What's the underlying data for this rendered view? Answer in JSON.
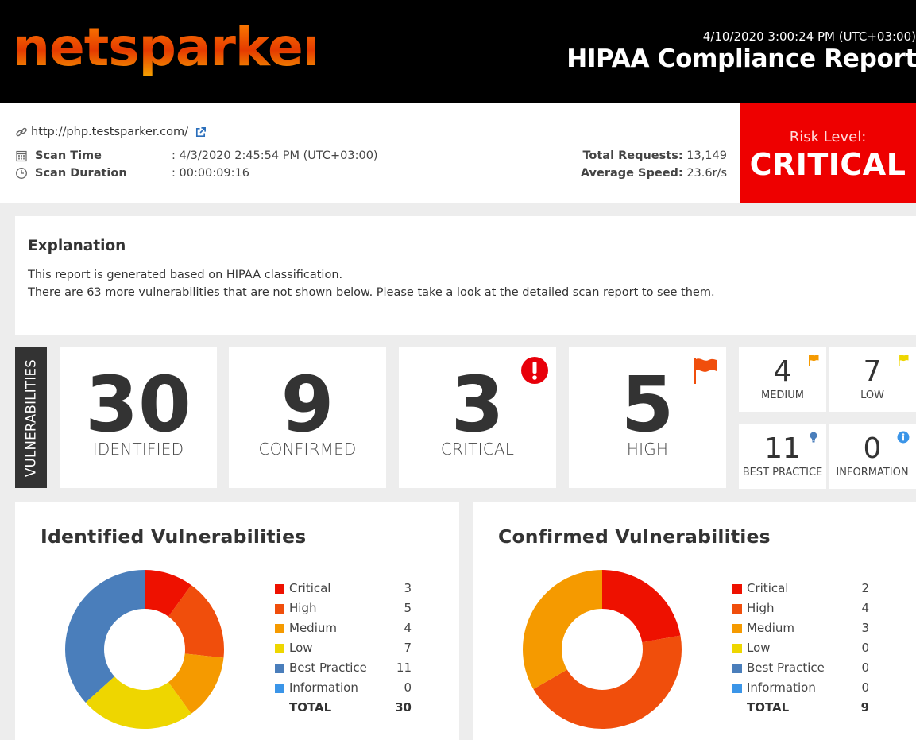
{
  "header": {
    "logo_text": "netsparker",
    "date": "4/10/2020 3:00:24 PM (UTC+03:00)",
    "title": "HIPAA Compliance Report"
  },
  "scan": {
    "url": "http://php.testsparker.com/",
    "scan_time_label": "Scan Time",
    "scan_time_value": ": 4/3/2020 2:45:54 PM (UTC+03:00)",
    "scan_duration_label": "Scan Duration",
    "scan_duration_value": ": 00:00:09:16",
    "total_requests_label": "Total Requests:",
    "total_requests_value": "13,149",
    "average_speed_label": "Average Speed:",
    "average_speed_value": "23.6r/s"
  },
  "risk": {
    "label": "Risk Level:",
    "value": "CRITICAL",
    "color": "#ee0000"
  },
  "explanation": {
    "heading": "Explanation",
    "line1": "This report is generated based on HIPAA classification.",
    "line2": "There are 63 more vulnerabilities that are not shown below. Please take a look at the detailed scan report to see them."
  },
  "vulnerabilities": {
    "tab_label": "VULNERABILITIES",
    "identified": {
      "count": "30",
      "label": "IDENTIFIED"
    },
    "confirmed": {
      "count": "9",
      "label": "CONFIRMED"
    },
    "critical": {
      "count": "3",
      "label": "CRITICAL",
      "icon": "exclamation-circle-icon"
    },
    "high": {
      "count": "5",
      "label": "HIGH",
      "icon": "flag-icon"
    },
    "medium": {
      "count": "4",
      "label": "MEDIUM",
      "icon": "flag-icon"
    },
    "low": {
      "count": "7",
      "label": "LOW",
      "icon": "flag-icon"
    },
    "best_practice": {
      "count": "11",
      "label": "BEST PRACTICE",
      "icon": "lightbulb-icon"
    },
    "information": {
      "count": "0",
      "label": "INFORMATION",
      "icon": "info-icon"
    }
  },
  "chart_data": [
    {
      "type": "pie",
      "title": "Identified Vulnerabilities",
      "categories": [
        "Critical",
        "High",
        "Medium",
        "Low",
        "Best Practice",
        "Information"
      ],
      "values": [
        3,
        5,
        4,
        7,
        11,
        0
      ],
      "colors": [
        "#ee1100",
        "#f04e0c",
        "#f59a00",
        "#eed600",
        "#4a7ebb",
        "#3b95e8"
      ],
      "total_label": "TOTAL",
      "total": 30,
      "legend": "right"
    },
    {
      "type": "pie",
      "title": "Confirmed Vulnerabilities",
      "categories": [
        "Critical",
        "High",
        "Medium",
        "Low",
        "Best Practice",
        "Information"
      ],
      "values": [
        2,
        4,
        3,
        0,
        0,
        0
      ],
      "colors": [
        "#ee1100",
        "#f04e0c",
        "#f59a00",
        "#eed600",
        "#4a7ebb",
        "#3b95e8"
      ],
      "total_label": "TOTAL",
      "total": 9,
      "legend": "right"
    }
  ]
}
